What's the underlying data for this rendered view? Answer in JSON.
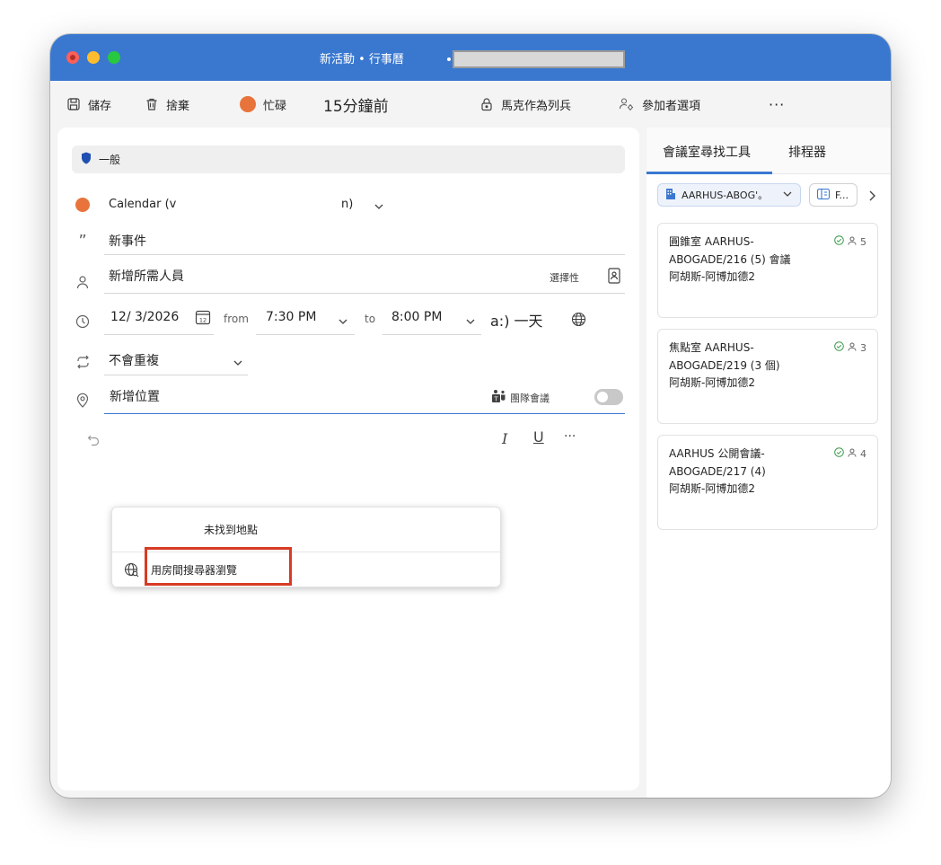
{
  "window": {
    "title": "新活動 • 行事曆"
  },
  "toolbar": {
    "save": "儲存",
    "discard": "捨棄",
    "busy": "忙碌",
    "reminder": "15分鐘前",
    "private": "馬克作為列兵",
    "attendee_options": "參加者選項",
    "more": "···"
  },
  "form": {
    "category": "一般",
    "calendar": "Calendar (v",
    "calendar_suffix": "n)",
    "title_placeholder": "新事件",
    "attendees_placeholder": "新增所需人員",
    "optional_label": "選擇性",
    "date": "12/ 3/2026",
    "from_label": "from",
    "start_time": "7:30 PM",
    "to_label": "to",
    "end_time": "8:00 PM",
    "all_day": "a:) 一天",
    "recurrence": "不會重複",
    "location_placeholder": "新增位置",
    "teams_meeting": "團隊會議",
    "teams_meeting_on": false
  },
  "location_dropdown": {
    "no_results": "未找到地點",
    "browse_rooms": "用房間搜尋器瀏覽"
  },
  "sidebar": {
    "tabs": [
      "會議室尋找工具",
      "排程器"
    ],
    "building_filter": "AARHUS-ABOG'。",
    "floor_filter": "F...",
    "rooms": [
      {
        "name": "圓錐室 AARHUS-ABOGADE/216 (5) 會議",
        "location": "阿胡斯-阿博加德2",
        "capacity": "5"
      },
      {
        "name": "焦點室 AARHUS-ABOGADE/219 (3 個)",
        "location": "阿胡斯-阿博加德2",
        "capacity": "3"
      },
      {
        "name": "AARHUS 公開會議-ABOGADE/217 (4)",
        "location": "阿胡斯-阿博加德2",
        "capacity": "4"
      }
    ]
  },
  "colors": {
    "titlebar": "#3a78d0",
    "busy": "#e8743b",
    "highlight": "#d83b24"
  }
}
